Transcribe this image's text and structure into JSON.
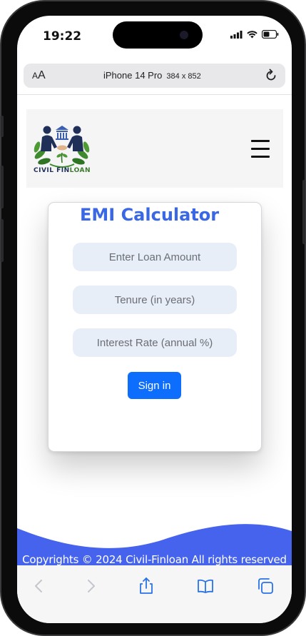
{
  "status_bar": {
    "time": "19:22"
  },
  "browser": {
    "aa_label": "AA",
    "device_name": "iPhone 14 Pro",
    "device_size": "384 x 852"
  },
  "site": {
    "logo_text_1": "CIVIL ",
    "logo_text_2": "FIN",
    "logo_text_3": "LOAN"
  },
  "calculator": {
    "title": "EMI Calculator",
    "loan_amount_placeholder": "Enter Loan Amount",
    "tenure_placeholder": "Tenure (in years)",
    "interest_placeholder": "Interest Rate (annual %)",
    "submit_label": "Sign in"
  },
  "footer": {
    "copyright": "Copyrights © 2024 Civil-Finloan All rights reserved"
  },
  "colors": {
    "accent_blue": "#3a67e6",
    "button_blue": "#0d6efd",
    "wave_blue": "#4563ec"
  },
  "icons": {
    "toolbar": [
      "back-icon",
      "forward-icon",
      "share-icon",
      "bookmarks-icon",
      "tabs-icon"
    ]
  }
}
